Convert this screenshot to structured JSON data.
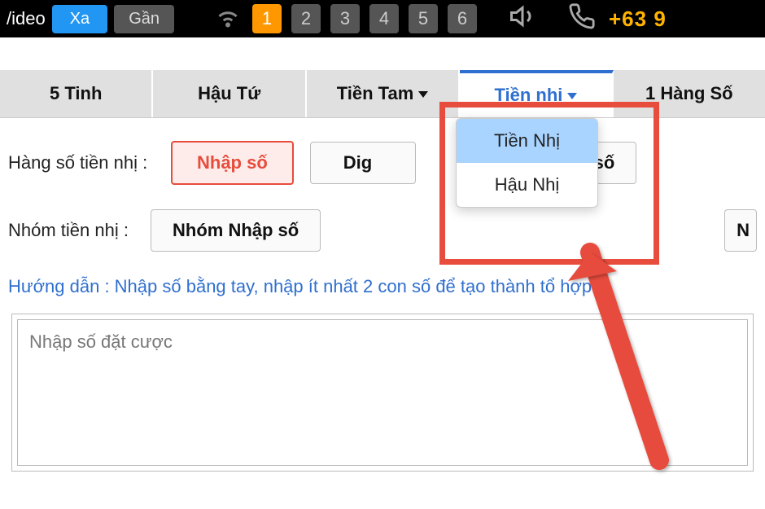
{
  "topbar": {
    "video_label": "/ideo",
    "xa": "Xa",
    "gan": "Gần",
    "numbers": [
      "1",
      "2",
      "3",
      "4",
      "5",
      "6"
    ],
    "phone": "+63 9"
  },
  "tabs": [
    {
      "label": "5 Tinh",
      "caret": false,
      "active": false
    },
    {
      "label": "Hậu Tứ",
      "caret": false,
      "active": false
    },
    {
      "label": "Tiền Tam",
      "caret": true,
      "active": false
    },
    {
      "label": "Tiền nhị",
      "caret": true,
      "active": true
    },
    {
      "label": "1 Hàng Số",
      "caret": false,
      "active": false
    }
  ],
  "row1": {
    "label": "Hàng số tiền nhị :",
    "btn_nhap": "Nhập số",
    "btn_dig": "Dig",
    "btn_ep": "ép số"
  },
  "row2": {
    "label": "Nhóm tiền nhị :",
    "btn_nhom_nhap": "Nhóm Nhập số",
    "btn_partial": "N"
  },
  "hint": "Hướng dẫn : Nhập số bằng tay, nhập ít nhất 2 con số để tạo thành tổ hợp.",
  "textarea": {
    "placeholder": "Nhập số đặt cược"
  },
  "dropdown": {
    "items": [
      {
        "label": "Tiền Nhị",
        "selected": true
      },
      {
        "label": "Hậu Nhị",
        "selected": false
      }
    ]
  }
}
